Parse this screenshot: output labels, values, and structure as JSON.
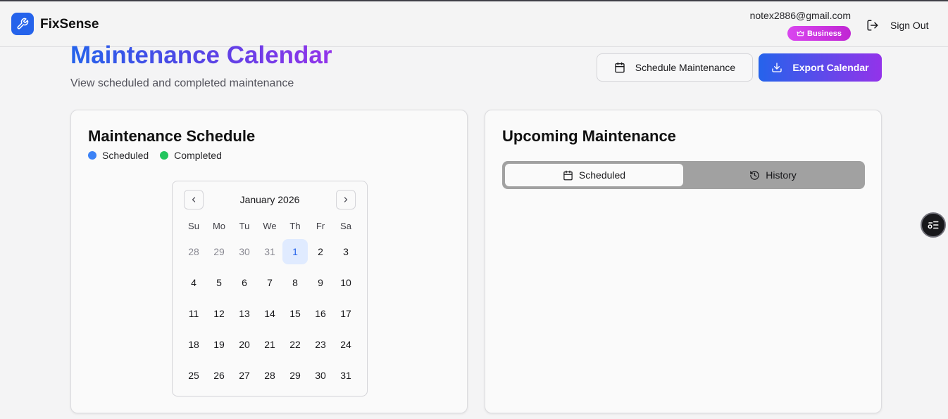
{
  "header": {
    "brand": "FixSense",
    "email": "notex2886@gmail.com",
    "plan_badge": "Business",
    "sign_out": "Sign Out"
  },
  "page": {
    "title": "Maintenance Calendar",
    "subtitle": "View scheduled and completed maintenance",
    "schedule_button": "Schedule Maintenance",
    "export_button": "Export Calendar"
  },
  "schedule_card": {
    "title": "Maintenance Schedule",
    "legend": [
      {
        "label": "Scheduled",
        "color": "#3b82f6"
      },
      {
        "label": "Completed",
        "color": "#22c55e"
      }
    ],
    "calendar": {
      "month": "January 2026",
      "weekdays": [
        "Su",
        "Mo",
        "Tu",
        "We",
        "Th",
        "Fr",
        "Sa"
      ],
      "days": [
        {
          "d": "28",
          "muted": true
        },
        {
          "d": "29",
          "muted": true
        },
        {
          "d": "30",
          "muted": true
        },
        {
          "d": "31",
          "muted": true
        },
        {
          "d": "1",
          "today": true
        },
        {
          "d": "2"
        },
        {
          "d": "3"
        },
        {
          "d": "4"
        },
        {
          "d": "5"
        },
        {
          "d": "6"
        },
        {
          "d": "7"
        },
        {
          "d": "8"
        },
        {
          "d": "9"
        },
        {
          "d": "10"
        },
        {
          "d": "11"
        },
        {
          "d": "12"
        },
        {
          "d": "13"
        },
        {
          "d": "14"
        },
        {
          "d": "15"
        },
        {
          "d": "16"
        },
        {
          "d": "17"
        },
        {
          "d": "18"
        },
        {
          "d": "19"
        },
        {
          "d": "20"
        },
        {
          "d": "21"
        },
        {
          "d": "22"
        },
        {
          "d": "23"
        },
        {
          "d": "24"
        },
        {
          "d": "25"
        },
        {
          "d": "26"
        },
        {
          "d": "27"
        },
        {
          "d": "28"
        },
        {
          "d": "29"
        },
        {
          "d": "30"
        },
        {
          "d": "31"
        }
      ]
    }
  },
  "upcoming_card": {
    "title": "Upcoming Maintenance",
    "tabs": [
      {
        "label": "Scheduled",
        "icon": "calendar-icon",
        "active": true
      },
      {
        "label": "History",
        "icon": "history-icon",
        "active": false
      }
    ]
  }
}
